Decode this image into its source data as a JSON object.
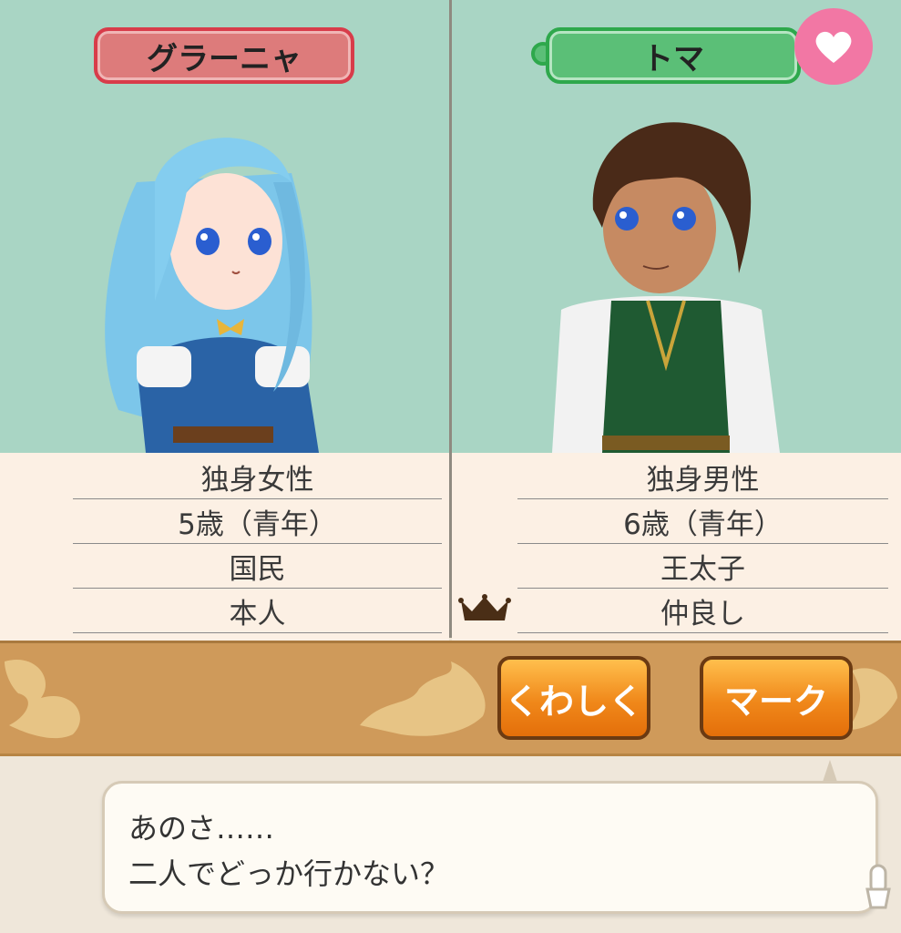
{
  "left": {
    "name": "グラーニャ",
    "info": [
      "独身女性",
      "5歳（青年）",
      "国民",
      "本人"
    ]
  },
  "right": {
    "name": "トマ",
    "info": [
      "独身男性",
      "6歳（青年）",
      "王太子",
      "仲良し"
    ]
  },
  "buttons": {
    "details": "くわしく",
    "mark": "マーク"
  },
  "dialogue": {
    "line1": "あのさ……",
    "line2": "二人でどっか行かない？"
  },
  "colors": {
    "portrait_bg": "#a9d5c4",
    "left_plate": "#dd7b7b",
    "right_plate": "#5bbf77",
    "heart_badge": "#f277a4",
    "button": "#f0881a",
    "banner": "#cf9a5a"
  },
  "icons": [
    "heart-icon",
    "crown-icon",
    "tap-indicator-icon"
  ]
}
